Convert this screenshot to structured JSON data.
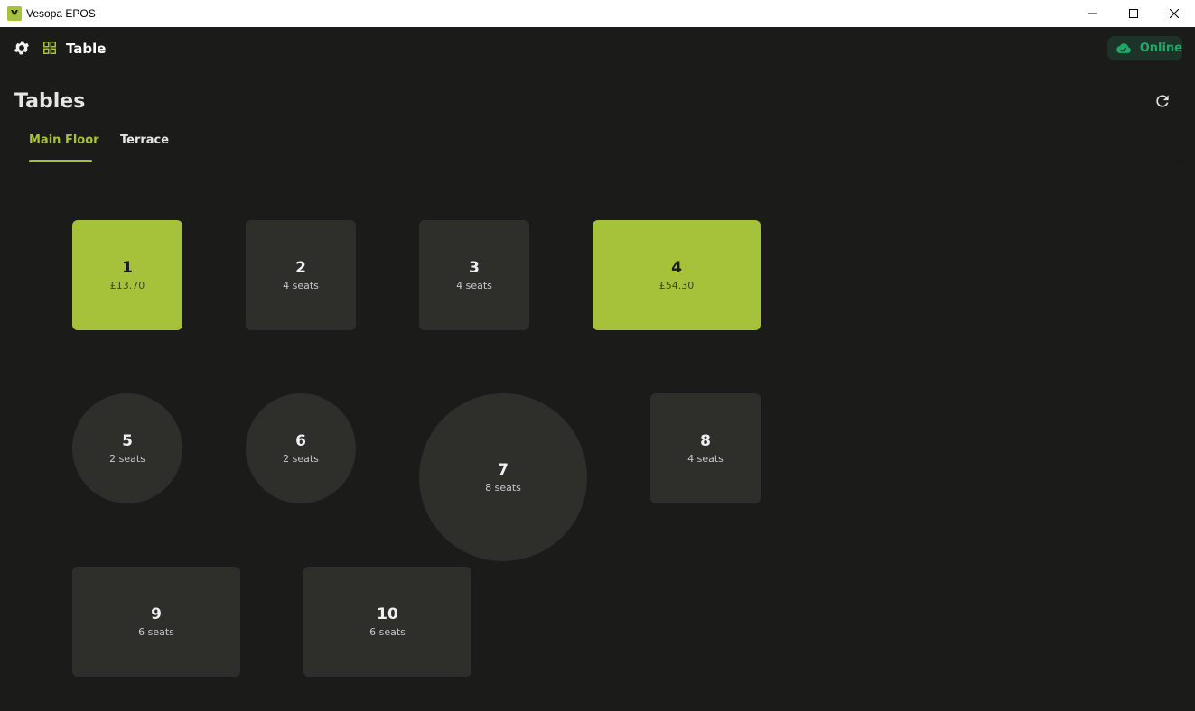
{
  "window": {
    "title": "Vesopa EPOS"
  },
  "header": {
    "title": "Table",
    "status": "Online"
  },
  "page": {
    "title": "Tables"
  },
  "tabs": [
    {
      "label": "Main Floor",
      "active": true
    },
    {
      "label": "Terrace",
      "active": false
    }
  ],
  "tables": [
    {
      "number": "1",
      "sub": "£13.70",
      "shape": "square",
      "occupied": true
    },
    {
      "number": "2",
      "sub": "4 seats",
      "shape": "square",
      "occupied": false
    },
    {
      "number": "3",
      "sub": "4 seats",
      "shape": "square",
      "occupied": false
    },
    {
      "number": "4",
      "sub": "£54.30",
      "shape": "rect",
      "occupied": true
    },
    {
      "number": "5",
      "sub": "2 seats",
      "shape": "round",
      "occupied": false
    },
    {
      "number": "6",
      "sub": "2 seats",
      "shape": "round",
      "occupied": false
    },
    {
      "number": "7",
      "sub": "8 seats",
      "shape": "round",
      "occupied": false
    },
    {
      "number": "8",
      "sub": "4 seats",
      "shape": "square",
      "occupied": false
    },
    {
      "number": "9",
      "sub": "6 seats",
      "shape": "rect",
      "occupied": false
    },
    {
      "number": "10",
      "sub": "6 seats",
      "shape": "rect",
      "occupied": false
    }
  ],
  "colors": {
    "accent": "#a6c23a",
    "online": "#1fa866",
    "background": "#1b1b19",
    "table": "#2e2e2b"
  },
  "icons": [
    "app-logo-icon",
    "minimize-icon",
    "maximize-icon",
    "close-icon",
    "gear-icon",
    "grid-icon",
    "cloud-check-icon",
    "refresh-icon"
  ]
}
